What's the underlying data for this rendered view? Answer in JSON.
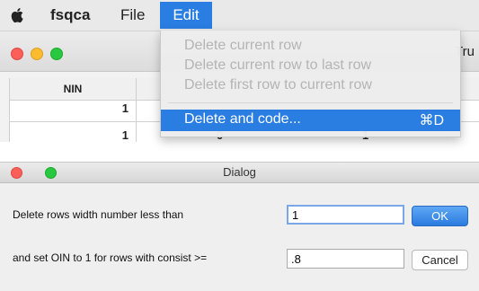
{
  "menubar": {
    "app_name": "fsqca",
    "file_label": "File",
    "edit_label": "Edit"
  },
  "window": {
    "partial_tab": "Tru",
    "grid": {
      "column_header": "NIN",
      "row1_value": "1",
      "row2_values": [
        "1",
        "0",
        "1"
      ]
    }
  },
  "edit_menu": {
    "items": [
      {
        "label": "Delete current row",
        "enabled": false
      },
      {
        "label": "Delete current row to last row",
        "enabled": false
      },
      {
        "label": "Delete first row to current row",
        "enabled": false
      }
    ],
    "active_item": {
      "label": "Delete and code...",
      "shortcut": "⌘D"
    }
  },
  "dialog": {
    "title": "Dialog",
    "row1_label": "Delete rows width number less than",
    "row1_value": "1",
    "row2_label": "and set OIN to 1 for rows with consist >=",
    "row2_value": ".8",
    "ok_label": "OK",
    "cancel_label": "Cancel"
  },
  "colors": {
    "accent": "#2a7de1",
    "close": "#fc5f57",
    "minimize": "#fdbc2e",
    "zoom": "#28c840"
  }
}
